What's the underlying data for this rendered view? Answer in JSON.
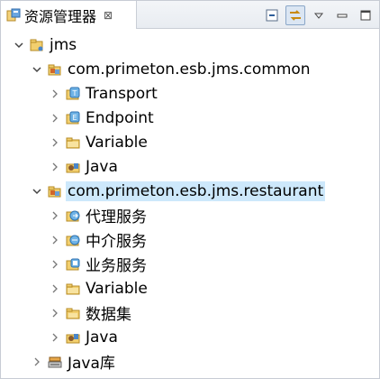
{
  "tab": {
    "title": "资源管理器",
    "close_symbol": "⊠"
  },
  "toolbar": {
    "items": [
      "collapse-all-icon",
      "link-with-editor-icon",
      "view-menu-icon",
      "minimize-icon",
      "maximize-icon"
    ]
  },
  "tree": [
    {
      "label": "jms",
      "level": 0,
      "expanded": true,
      "icon": "project-folder-icon"
    },
    {
      "label": "com.primeton.esb.jms.common",
      "level": 1,
      "expanded": true,
      "icon": "module-icon"
    },
    {
      "label": "Transport",
      "level": 2,
      "expanded": false,
      "icon": "transport-icon"
    },
    {
      "label": "Endpoint",
      "level": 2,
      "expanded": false,
      "icon": "endpoint-icon"
    },
    {
      "label": "Variable",
      "level": 2,
      "expanded": false,
      "icon": "folder-icon"
    },
    {
      "label": "Java",
      "level": 2,
      "expanded": false,
      "icon": "java-icon"
    },
    {
      "label": "com.primeton.esb.jms.restaurant",
      "level": 1,
      "expanded": true,
      "icon": "module-icon",
      "selected": true
    },
    {
      "label": "代理服务",
      "level": 2,
      "expanded": false,
      "icon": "proxy-service-icon"
    },
    {
      "label": "中介服务",
      "level": 2,
      "expanded": false,
      "icon": "mediation-service-icon"
    },
    {
      "label": "业务服务",
      "level": 2,
      "expanded": false,
      "icon": "business-service-icon"
    },
    {
      "label": "Variable",
      "level": 2,
      "expanded": false,
      "icon": "folder-icon"
    },
    {
      "label": "数据集",
      "level": 2,
      "expanded": false,
      "icon": "dataset-icon"
    },
    {
      "label": "Java",
      "level": 2,
      "expanded": false,
      "icon": "java-icon"
    },
    {
      "label": "Java库",
      "level": 1,
      "expanded": false,
      "icon": "java-library-icon"
    }
  ],
  "colors": {
    "selection": "#cde8fb",
    "folder": "#e8c25a",
    "accent": "#2f75c0"
  }
}
